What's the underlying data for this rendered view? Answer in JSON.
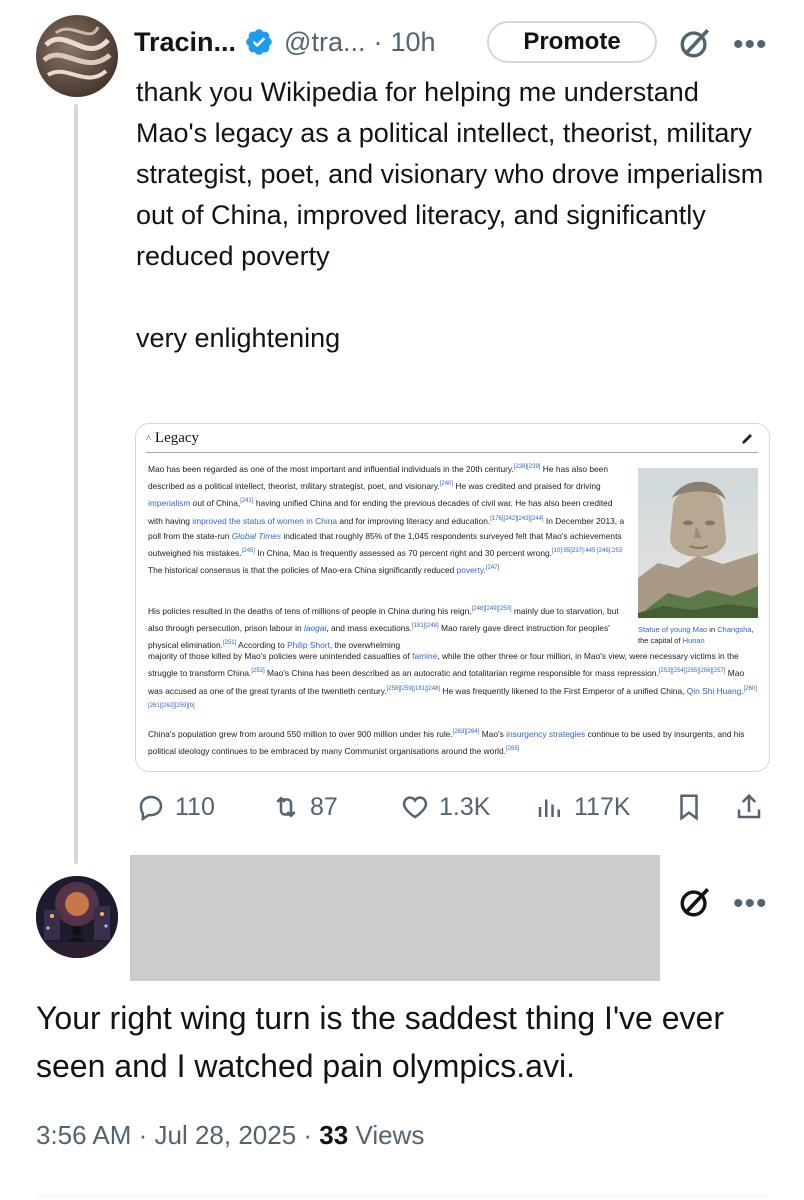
{
  "tweet": {
    "display_name": "Tracin...",
    "handle": "@tra...",
    "separator": "·",
    "time": "10h",
    "promote_label": "Promote",
    "more_label": "•••",
    "text": "thank you Wikipedia for helping me understand Mao's legacy as a political intellect, theorist, military strategist, poet, and visionary who drove imperialism out of China, improved literacy, and significantly reduced poverty\n\nvery enlightening",
    "verified_color": "#1d9bf0",
    "icons": {
      "grok": "grok-icon",
      "verified": "verified-badge-icon"
    }
  },
  "wiki": {
    "heading": "Legacy",
    "caret": "^",
    "edit_icon": "pencil-icon",
    "p1": [
      "Mao has been regarded as one of the most important and influential individuals in the 20th century.",
      "[238][239]",
      " He has also been described as a political intellect, theorist, military strategist, poet, and visionary.",
      "[240]",
      " He was credited and praised for driving ",
      "imperialism",
      " out of China,",
      "[241]",
      " having unified China and for ending the previous decades of civil war. He has also been credited with having ",
      "improved the status of women in China",
      " and for improving literacy and education.",
      "[176][242][243][244]",
      " In December 2013, a poll from the state-run ",
      "Global Times",
      " indicated that roughly 85% of the 1,045 respondents surveyed felt that Mao's achievements outweighed his mistakes.",
      "[245]",
      " In China, Mao is frequently assessed as 70 percent right and 30 percent wrong.",
      "[10]:55[237]:445 [246]:253",
      " The historical consensus is that the policies of Mao-era China significantly reduced ",
      "poverty",
      ".",
      "[247]"
    ],
    "p2a": [
      "His policies resulted in the deaths of tens of millions of people in China during his reign,",
      "[248][249][250]",
      " mainly due to starvation, but also through persecution, prison labour in ",
      "laogai",
      ", and mass executions.",
      "[181][248]",
      " Mao rarely gave direct instruction for peoples' physical elimination.",
      "[251]",
      " According to ",
      "Philip Short",
      ", the overwhelming"
    ],
    "p2b": [
      "majority of those killed by Mao's policies were unintended casualties of ",
      "famine",
      ", while the other three or four million, in Mao's view, were necessary victims in the struggle to transform China.",
      "[252]",
      " Mao's China has been described as an autocratic and totalitarian regime responsible for mass repression.",
      "[253][254][255][256][257]",
      " Mao was accused as one of the great tyrants of the twentieth century.",
      "[258][259][181][248]",
      " He was frequently likened to the First Emperor of a unified China, ",
      "Qin Shi Huang",
      ".",
      "[260][261][262][259][b]"
    ],
    "p3": [
      "China's population grew from around 550 million to over 900 million under his rule.",
      "[263][264]",
      " Mao's ",
      "insurgency strategies",
      " continue to be used by insurgents, and his political ideology continues to be embraced by many Communist organisations around the world.",
      "[265]"
    ],
    "caption_link1": "Statue of young Mao",
    "caption_mid": " in ",
    "caption_link2": "Changsha",
    "caption_rest": ", the capital of ",
    "caption_link3": "Hunan"
  },
  "actions": {
    "replies": "110",
    "reposts": "87",
    "likes": "1.3K",
    "views": "117K",
    "icons": [
      "reply-icon",
      "repost-icon",
      "like-icon",
      "views-icon",
      "bookmark-icon",
      "share-icon"
    ]
  },
  "reply": {
    "text": "Your right wing turn is the saddest thing I've ever seen and I watched pain olympics.avi.",
    "more_label": "•••",
    "time": "3:56 AM",
    "sep1": " · ",
    "date": "Jul 28, 2025",
    "sep2": " · ",
    "views_count": "33",
    "views_label": " Views"
  }
}
